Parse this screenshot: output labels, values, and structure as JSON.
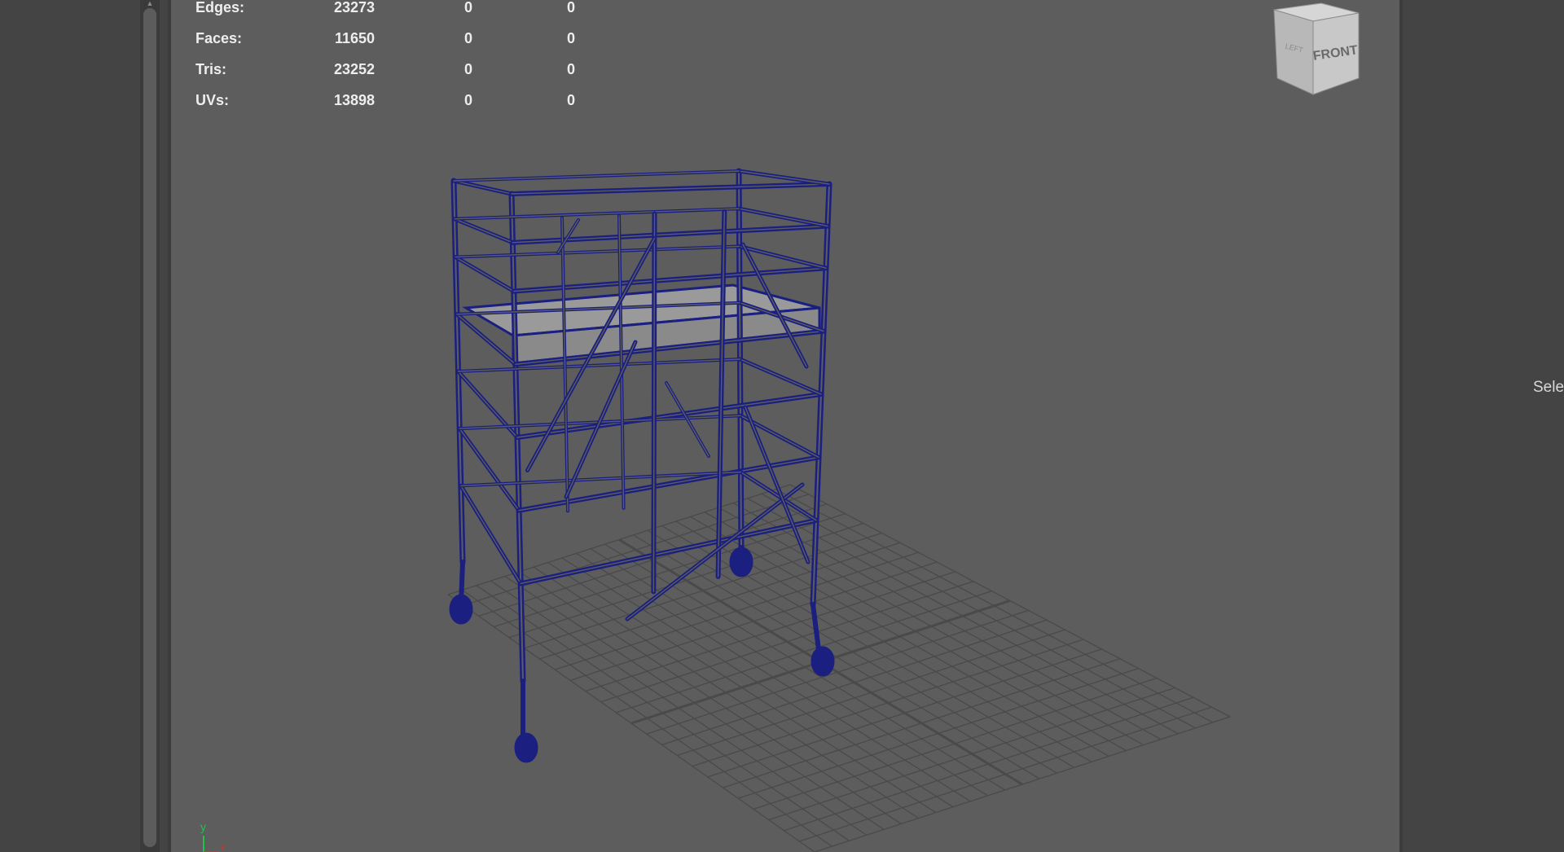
{
  "hud": {
    "rows": [
      {
        "label": "Edges:",
        "v1": "23273",
        "v2": "0",
        "v3": "0"
      },
      {
        "label": "Faces:",
        "v1": "11650",
        "v2": "0",
        "v3": "0"
      },
      {
        "label": "Tris:",
        "v1": "23252",
        "v2": "0",
        "v3": "0"
      },
      {
        "label": "UVs:",
        "v1": "13898",
        "v2": "0",
        "v3": "0"
      }
    ]
  },
  "viewcube": {
    "front_label": "FRONT",
    "side_label": "LEFT"
  },
  "axis": {
    "y_label": "y",
    "x_label": "x"
  },
  "right_panel": {
    "label": "Sele"
  },
  "colors": {
    "viewport_bg": "#5d5d5d",
    "wireframe": "#1a1f80",
    "grid": "#4a4a4a",
    "platform": "#9a9a9a"
  }
}
